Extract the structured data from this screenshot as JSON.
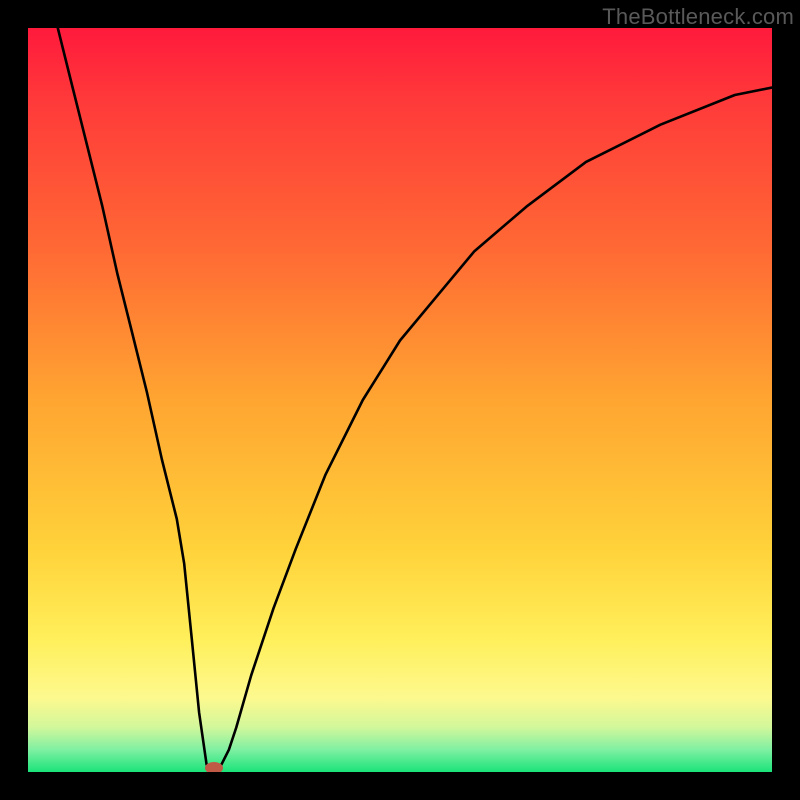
{
  "watermark": "TheBottleneck.com",
  "chart_data": {
    "type": "line",
    "title": "",
    "xlabel": "",
    "ylabel": "",
    "xlim": [
      0,
      100
    ],
    "ylim": [
      0,
      100
    ],
    "grid": false,
    "legend": false,
    "series": [
      {
        "name": "bottleneck-curve",
        "x": [
          4,
          6,
          8,
          10,
          12,
          14,
          16,
          18,
          20,
          21,
          22,
          23,
          24,
          25,
          26,
          27,
          28,
          30,
          33,
          36,
          40,
          45,
          50,
          55,
          60,
          67,
          75,
          85,
          95,
          100
        ],
        "y": [
          100,
          92,
          84,
          76,
          67,
          59,
          51,
          42,
          34,
          28,
          18,
          8,
          1,
          0,
          1,
          3,
          6,
          13,
          22,
          30,
          40,
          50,
          58,
          64,
          70,
          76,
          82,
          87,
          91,
          92
        ]
      }
    ],
    "markers": [
      {
        "name": "optimum-point",
        "x": 25,
        "y": 0,
        "color": "#c05a47"
      }
    ],
    "background_gradient": {
      "direction": "vertical",
      "stops": [
        {
          "pos": 0.0,
          "color": "#ff1a3c"
        },
        {
          "pos": 0.5,
          "color": "#ffa531"
        },
        {
          "pos": 0.82,
          "color": "#ffef5a"
        },
        {
          "pos": 1.0,
          "color": "#1be37a"
        }
      ]
    }
  }
}
